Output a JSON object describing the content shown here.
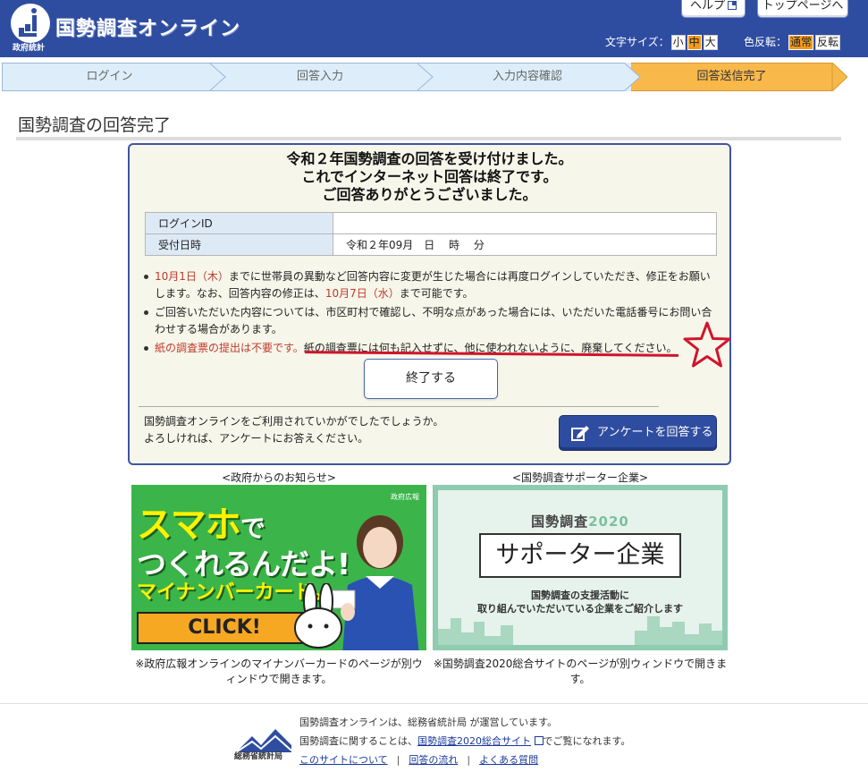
{
  "header": {
    "site_title": "国勢調査オンライン",
    "org_label": "政府統計",
    "help_label": "ヘルプ",
    "top_label": "トップページへ",
    "font_size_label": "文字サイズ：",
    "font_small": "小",
    "font_medium": "中",
    "font_large": "大",
    "contrast_label": "色反転：",
    "contrast_normal": "通常",
    "contrast_inverse": "反転"
  },
  "steps": [
    "ログイン",
    "回答入力",
    "入力内容確認",
    "回答送信完了"
  ],
  "page_title": "国勢調査の回答完了",
  "main": {
    "lead1": "令和２年国勢調査の回答を受け付けました。",
    "lead2": "これでインターネット回答は終了です。",
    "lead3": "ご回答ありがとうございました。",
    "table": {
      "login_id_label": "ログインID",
      "login_id_value": "",
      "received_label": "受付日時",
      "received_value": "令和２年09月　日　 時　 分"
    },
    "note1_red1": "10月1日（木）",
    "note1_text1": "までに世帯員の異動など回答内容に変更が生じた場合には再度ログインしていただき、修正をお願いします。なお、回答内容の修正は、",
    "note1_red2": "10月7日（水）",
    "note1_text2": "まで可能です。",
    "note2": "ご回答いただいた内容については、市区町村で確認し、不明な点があった場合には、いただいた電話番号にお問い合わせする場合があります。",
    "note3_red": "紙の調査票の提出は不要です。",
    "note3_text": "紙の調査票には何も記入せずに、他に使われないように、廃棄してください。",
    "end_button": "終了する",
    "survey_line1": "国勢調査オンラインをご利用されていかがでしたでしょうか。",
    "survey_line2": "よろしければ、アンケートにお答えください。",
    "survey_button": "アンケートを回答する"
  },
  "banners": {
    "left_label": "<政府からのお知らせ>",
    "right_label": "<国勢調査サポーター企業>",
    "left": {
      "line1": "スマホ",
      "line1b": "で",
      "line2": "つくれるんだよ!",
      "line3": "マイナンバーカード。",
      "click": "CLICK!",
      "pr": "政府広報"
    },
    "right": {
      "kokusei": "国勢調査",
      "year": "2020",
      "title": "サポーター企業",
      "desc1": "国勢調査の支援活動に",
      "desc2": "取り組んでいただいている企業をご紹介します"
    },
    "left_note": "※政府広報オンラインのマイナンバーカードのページが別ウィンドウで開きます。",
    "right_note": "※国勢調査2020総合サイトのページが別ウィンドウで開きます。"
  },
  "footer": {
    "org": "総務省統計局",
    "line1": "国勢調査オンラインは、総務省統計局 が運営しています。",
    "line2a": "国勢調査に関することは、",
    "line2_link": "国勢調査2020総合サイト",
    "line2b": "でご覧になれます。",
    "link_about": "このサイトについて",
    "link_flow": "回答の流れ",
    "link_faq": "よくある質問"
  },
  "colors": {
    "header_bg": "#2f4da0",
    "active_step": "#f8b84a",
    "accent_red": "#c0392b",
    "mark_red": "#d0142c"
  }
}
